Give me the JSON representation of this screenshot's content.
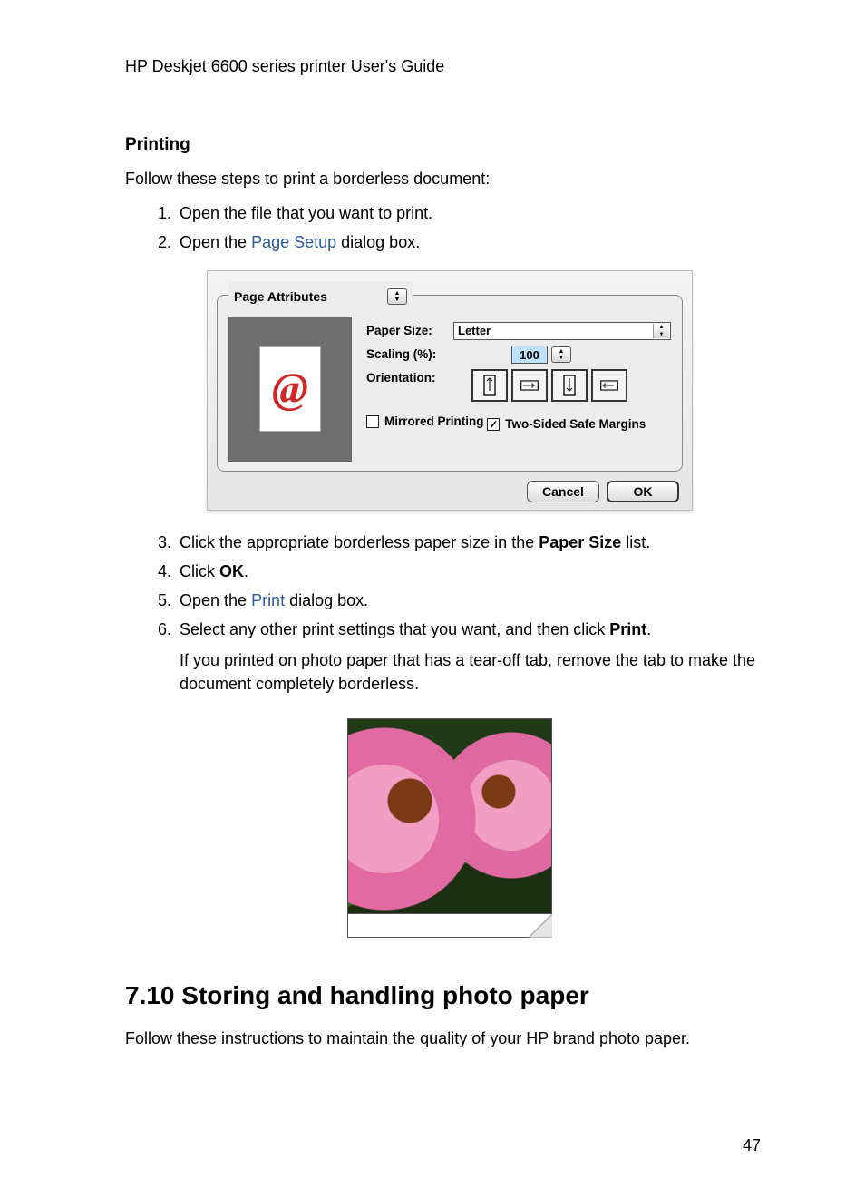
{
  "document": {
    "header_title": "HP Deskjet 6600 series printer User's Guide",
    "page_number": "47"
  },
  "printing": {
    "heading": "Printing",
    "intro": "Follow these steps to print a borderless document:",
    "steps": {
      "s1": "Open the file that you want to print.",
      "s2_a": "Open the ",
      "s2_link": "Page Setup",
      "s2_b": " dialog box.",
      "s3_a": "Click the appropriate borderless paper size in the ",
      "s3_bold": "Paper Size",
      "s3_b": " list.",
      "s4_a": "Click ",
      "s4_bold": "OK",
      "s4_b": ".",
      "s5_a": "Open the ",
      "s5_link": "Print",
      "s5_b": " dialog box.",
      "s6_a": "Select any other print settings that you want, and then click ",
      "s6_bold": "Print",
      "s6_b": ".",
      "s6_para": "If you printed on photo paper that has a tear-off tab, remove the tab to make the document completely borderless."
    }
  },
  "dialog": {
    "tab_label": "Page Attributes",
    "paper_size_label": "Paper Size:",
    "paper_size_value": "Letter",
    "scaling_label": "Scaling (%):",
    "scaling_value": "100",
    "orientation_label": "Orientation:",
    "mirrored_label": "Mirrored Printing",
    "mirrored_checked": false,
    "twosided_label": "Two-Sided Safe Margins",
    "twosided_checked": true,
    "cancel_label": "Cancel",
    "ok_label": "OK",
    "preview_glyph": "@"
  },
  "section2": {
    "heading": "7.10  Storing and handling photo paper",
    "body": "Follow these instructions to maintain the quality of your HP brand photo paper."
  }
}
